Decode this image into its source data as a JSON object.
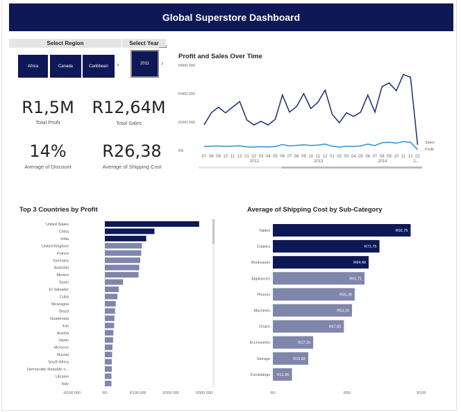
{
  "header": {
    "title": "Global Superstore Dashboard"
  },
  "region_slicer": {
    "title": "Select Region",
    "options": [
      "Africa",
      "Canada",
      "Caribbean"
    ]
  },
  "year_slicer": {
    "title": "Select Year",
    "selected": "2011"
  },
  "kpis": {
    "profit": {
      "value": "R1,5M",
      "label": "Total Profit"
    },
    "sales": {
      "value": "R12,64M",
      "label": "Total Sales"
    },
    "discount": {
      "value": "14%",
      "label": "Average of Discount"
    },
    "shipping": {
      "value": "R26,38",
      "label": "Average of Shipping Cost"
    }
  },
  "colors": {
    "navy": "#0f1856",
    "sales_line": "#1c2a70",
    "profit_line": "#2a8fd6",
    "lavender": "#8086ab"
  },
  "line_chart": {
    "title": "Profit and Sales Over Time",
    "y_ticks": [
      "R600 000",
      "R400 000",
      "R200 000",
      "R0"
    ],
    "month_ticks": [
      "07",
      "08",
      "09",
      "10",
      "11",
      "12",
      "01",
      "02",
      "03",
      "04",
      "05",
      "06",
      "07",
      "08",
      "09",
      "10",
      "11",
      "12",
      "01",
      "02",
      "03",
      "04",
      "05",
      "06",
      "07",
      "08",
      "09",
      "10",
      "11",
      "12",
      "01"
    ],
    "year_ticks": [
      "2012",
      "2013",
      "2014",
      "2..."
    ],
    "series_labels": [
      "Sales",
      "Profit"
    ]
  },
  "bar_left": {
    "title": "Top 3 Countries by Profit",
    "x_ticks": [
      "-R100 000",
      "R0",
      "R100 000",
      "R200 000",
      "R300 000"
    ]
  },
  "bar_right": {
    "title": "Average of Shipping Cost by Sub-Category",
    "x_ticks": [
      "R0",
      "R50",
      "R100"
    ],
    "value_labels": [
      "R92,75",
      "R71,75",
      "R64,49",
      "R61,71",
      "R55,08",
      "R53,25",
      "R47,82",
      "R27,16",
      "R23,83",
      "R12,85"
    ]
  },
  "chart_data": [
    {
      "type": "line",
      "title": "Profit and Sales Over Time",
      "x": [
        "2011-07",
        "2011-08",
        "2011-09",
        "2011-10",
        "2011-11",
        "2011-12",
        "2012-01",
        "2012-02",
        "2012-03",
        "2012-04",
        "2012-05",
        "2012-06",
        "2012-07",
        "2012-08",
        "2012-09",
        "2012-10",
        "2012-11",
        "2012-12",
        "2013-01",
        "2013-02",
        "2013-03",
        "2013-04",
        "2013-05",
        "2013-06",
        "2013-07",
        "2013-08",
        "2013-09",
        "2013-10",
        "2013-11",
        "2013-12",
        "2014-01"
      ],
      "series": [
        {
          "name": "Sales",
          "values": [
            180000,
            265000,
            305000,
            265000,
            305000,
            345000,
            215000,
            180000,
            205000,
            180000,
            220000,
            390000,
            270000,
            310000,
            400000,
            295000,
            340000,
            425000,
            255000,
            195000,
            265000,
            240000,
            270000,
            390000,
            270000,
            450000,
            475000,
            420000,
            535000,
            515000,
            40000
          ]
        },
        {
          "name": "Profit",
          "values": [
            28000,
            30000,
            32000,
            29000,
            31000,
            33000,
            26000,
            24000,
            27000,
            25000,
            28000,
            42000,
            32000,
            36000,
            40000,
            35000,
            38000,
            45000,
            30000,
            24000,
            30000,
            28000,
            32000,
            45000,
            35000,
            55000,
            58000,
            52000,
            62000,
            58000,
            6000
          ]
        }
      ],
      "ylim": [
        0,
        600000
      ],
      "y_ticks": [
        "R600 000",
        "R400 000",
        "R200 000",
        "R0"
      ]
    },
    {
      "type": "bar",
      "orientation": "horizontal",
      "title": "Top 3 Countries by Profit",
      "categories": [
        "United States",
        "China",
        "India",
        "United Kingdom",
        "France",
        "Germany",
        "Australia",
        "Mexico",
        "Spain",
        "El Salvador",
        "Cuba",
        "Nicaragua",
        "Brazil",
        "Guatemala",
        "Iran",
        "Austria",
        "Japan",
        "Morocco",
        "Russia",
        "South Africa",
        "Democratic Republic o...",
        "Ukraine",
        "Italy"
      ],
      "values": [
        285000,
        150000,
        125000,
        112000,
        110000,
        107000,
        104000,
        102000,
        55000,
        42000,
        38000,
        33000,
        31000,
        29000,
        28000,
        26000,
        25000,
        23000,
        22000,
        21000,
        21000,
        20000,
        20000
      ],
      "highlighted": [
        "United States",
        "China",
        "India"
      ],
      "xlim": [
        -100000,
        300000
      ]
    },
    {
      "type": "bar",
      "orientation": "horizontal",
      "title": "Average of Shipping Cost by Sub-Category",
      "categories": [
        "Tables",
        "Copiers",
        "Bookcases",
        "Appliances",
        "Phones",
        "Machines",
        "Chairs",
        "Accessories",
        "Storage",
        "Furnishings"
      ],
      "values": [
        92.75,
        71.75,
        64.49,
        61.71,
        55.08,
        53.25,
        47.82,
        27.16,
        23.83,
        12.85
      ],
      "highlighted": [
        "Tables",
        "Copiers",
        "Bookcases"
      ],
      "xlim": [
        0,
        100
      ]
    }
  ]
}
